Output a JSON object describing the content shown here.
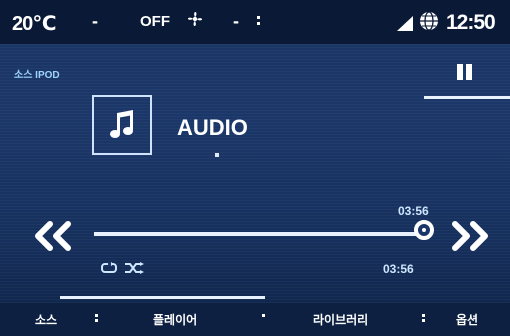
{
  "status_bar": {
    "temperature": "20℃",
    "left_dash": "-",
    "fan_label": "OFF",
    "fan_icon": "fan-icon",
    "right_dash": "-",
    "signal_icon": "signal-icon",
    "globe_icon": "globe-icon",
    "time": "12:50"
  },
  "source": {
    "label": "소스 IPOD"
  },
  "track": {
    "title": "AUDIO",
    "art_icon": "music-note-icon",
    "total_time": "03:56",
    "elapsed_time": "03:56",
    "progress_fraction": 1.0
  },
  "controls": {
    "prev_icon": "rewind-icon",
    "next_icon": "fast-forward-icon",
    "pause_icon": "pause-icon",
    "repeat_icon": "repeat-icon",
    "shuffle_icon": "shuffle-icon"
  },
  "bottom_nav": {
    "items": [
      {
        "label": "소스"
      },
      {
        "label": "플레이어"
      },
      {
        "label": "라이브러리"
      },
      {
        "label": "옵션"
      }
    ]
  },
  "colors": {
    "background": "#1b3769",
    "status_bar": "#0a1a36",
    "accent_text": "#9fd3ff",
    "foreground": "#ffffff"
  }
}
